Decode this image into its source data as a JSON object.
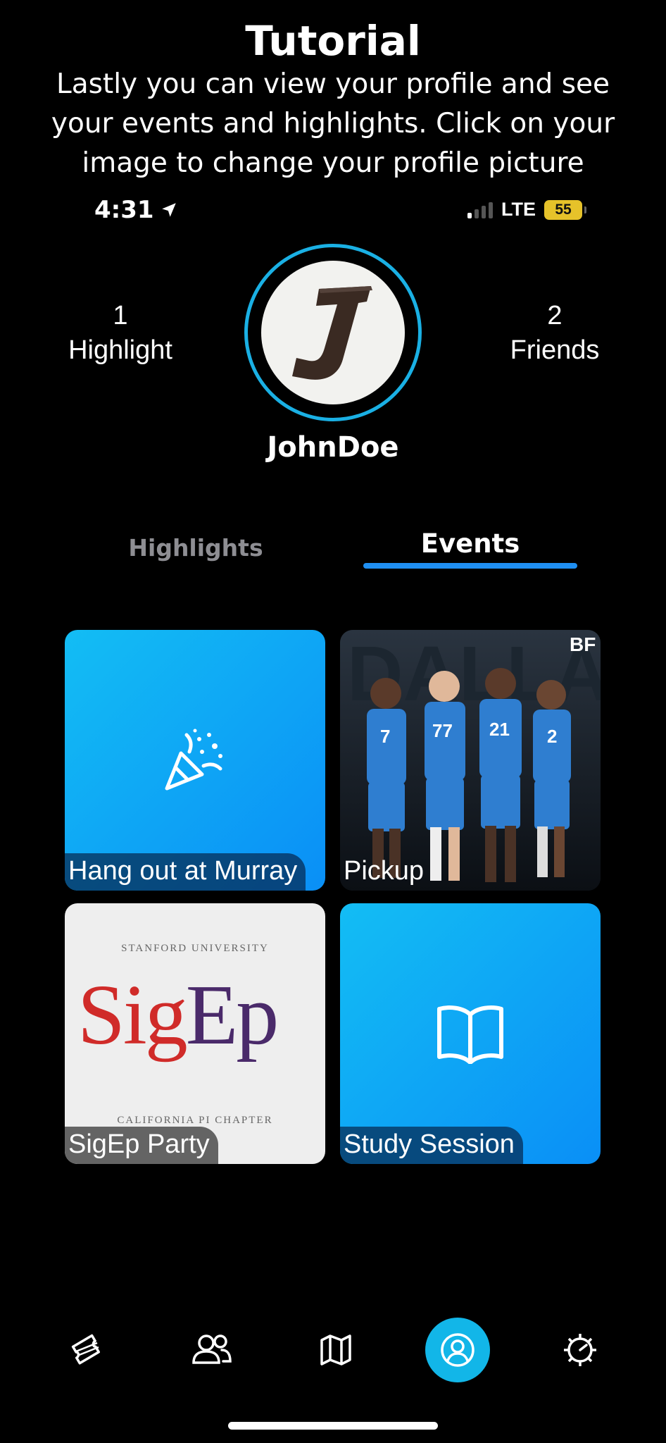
{
  "tutorial": {
    "title": "Tutorial",
    "text": "Lastly you can view your profile and see your events and highlights. Click on your image to change your profile picture"
  },
  "status_bar": {
    "time": "4:31",
    "network": "LTE",
    "battery": "55"
  },
  "profile": {
    "highlights_count": "1",
    "highlights_label": "Highlight",
    "friends_count": "2",
    "friends_label": "Friends",
    "avatar_letter": "J",
    "username": "JohnDoe"
  },
  "tabs": {
    "highlights": "Highlights",
    "events": "Events",
    "active": "Events"
  },
  "events": [
    {
      "label": "Hang out at Murray",
      "icon": "party-popper-icon"
    },
    {
      "label": "Pickup",
      "icon": "photo"
    },
    {
      "label": "SigEp Party",
      "icon": "photo"
    },
    {
      "label": "Study Session",
      "icon": "book-icon"
    }
  ],
  "sigep_image": {
    "top": "STANFORD UNIVERSITY",
    "word_sig": "Sig",
    "word_ep": "Ep",
    "bottom": "CALIFORNIA PI CHAPTER"
  },
  "pickup_image": {
    "brand": "BF",
    "jersey_text": "DALLAS",
    "numbers": [
      "7",
      "77",
      "21",
      "2"
    ]
  },
  "bottom_nav": {
    "items": [
      "tickets-icon",
      "friends-icon",
      "map-icon",
      "profile-icon",
      "settings-icon"
    ],
    "active": "profile-icon"
  },
  "colors": {
    "accent": "#12b6e8",
    "tab_underline": "#1f8ff2",
    "card_gradient_start": "#13bdf4",
    "card_gradient_end": "#0a8ff6"
  }
}
